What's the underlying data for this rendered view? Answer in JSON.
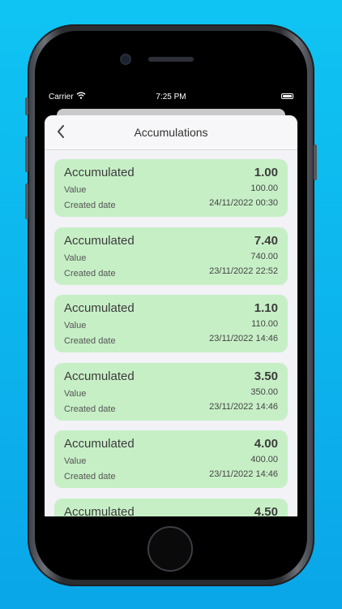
{
  "status_bar": {
    "carrier": "Carrier",
    "time": "7:25 PM"
  },
  "nav": {
    "title": "Accumulations",
    "back_icon": "chevron-left-icon"
  },
  "labels": {
    "value": "Value",
    "created_date": "Created date"
  },
  "items": [
    {
      "title": "Accumulated",
      "amount": "1.00",
      "value": "100.00",
      "created": "24/11/2022 00:30"
    },
    {
      "title": "Accumulated",
      "amount": "7.40",
      "value": "740.00",
      "created": "23/11/2022 22:52"
    },
    {
      "title": "Accumulated",
      "amount": "1.10",
      "value": "110.00",
      "created": "23/11/2022 14:46"
    },
    {
      "title": "Accumulated",
      "amount": "3.50",
      "value": "350.00",
      "created": "23/11/2022 14:46"
    },
    {
      "title": "Accumulated",
      "amount": "4.00",
      "value": "400.00",
      "created": "23/11/2022 14:46"
    },
    {
      "title": "Accumulated",
      "amount": "4.50"
    }
  ],
  "colors": {
    "background": "#0aa6e8",
    "card": "#c7efc6",
    "sheet": "#f2f2f7"
  }
}
